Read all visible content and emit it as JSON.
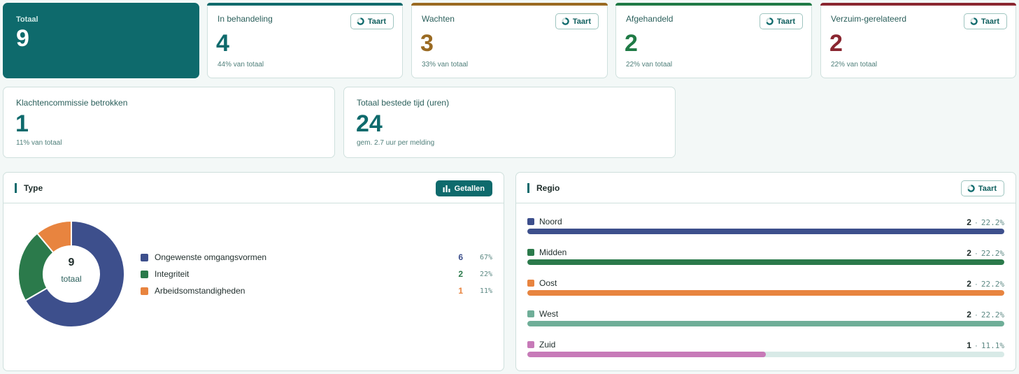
{
  "total": {
    "title": "Totaal",
    "value": "9"
  },
  "stats": [
    {
      "title": "In behandeling",
      "value": "4",
      "sub": "44% van totaal",
      "button": "Taart",
      "color": "#0e6a6c"
    },
    {
      "title": "Wachten",
      "value": "3",
      "sub": "33% van totaal",
      "button": "Taart",
      "color": "#9a6a22"
    },
    {
      "title": "Afgehandeld",
      "value": "2",
      "sub": "22% van totaal",
      "button": "Taart",
      "color": "#1f7a45"
    },
    {
      "title": "Verzuim-gerelateerd",
      "value": "2",
      "sub": "22% van totaal",
      "button": "Taart",
      "color": "#8a2630"
    }
  ],
  "klachten": {
    "title": "Klachtencommissie betrokken",
    "value": "1",
    "sub": "11% van totaal"
  },
  "tijd": {
    "title": "Totaal bestede tijd (uren)",
    "value": "24",
    "sub": "gem. 2.7 uur per melding"
  },
  "type_panel": {
    "title": "Type",
    "button": "Getallen",
    "center_value": "9",
    "center_label": "totaal",
    "items": [
      {
        "label": "Ongewenste omgangsvormen",
        "count": "6",
        "pct": "67%",
        "color": "#3d4f8c"
      },
      {
        "label": "Integriteit",
        "count": "2",
        "pct": "22%",
        "color": "#2b7a4b"
      },
      {
        "label": "Arbeidsomstandigheden",
        "count": "1",
        "pct": "11%",
        "color": "#e8843f"
      }
    ]
  },
  "regio_panel": {
    "title": "Regio",
    "button": "Taart",
    "separator": "·",
    "items": [
      {
        "label": "Noord",
        "count": "2",
        "pct": "22.2%",
        "fraction": 1.0,
        "color": "#3d4f8c"
      },
      {
        "label": "Midden",
        "count": "2",
        "pct": "22.2%",
        "fraction": 1.0,
        "color": "#2b7a4b"
      },
      {
        "label": "Oost",
        "count": "2",
        "pct": "22.2%",
        "fraction": 1.0,
        "color": "#e8843f"
      },
      {
        "label": "West",
        "count": "2",
        "pct": "22.2%",
        "fraction": 1.0,
        "color": "#6fae98"
      },
      {
        "label": "Zuid",
        "count": "1",
        "pct": "11.1%",
        "fraction": 0.5,
        "color": "#c77ab8"
      }
    ]
  },
  "chart_data": {
    "type": "pie",
    "categories": [
      "Ongewenste omgangsvormen",
      "Integriteit",
      "Arbeidsomstandigheden"
    ],
    "values": [
      6,
      2,
      1
    ],
    "title": "Type"
  }
}
